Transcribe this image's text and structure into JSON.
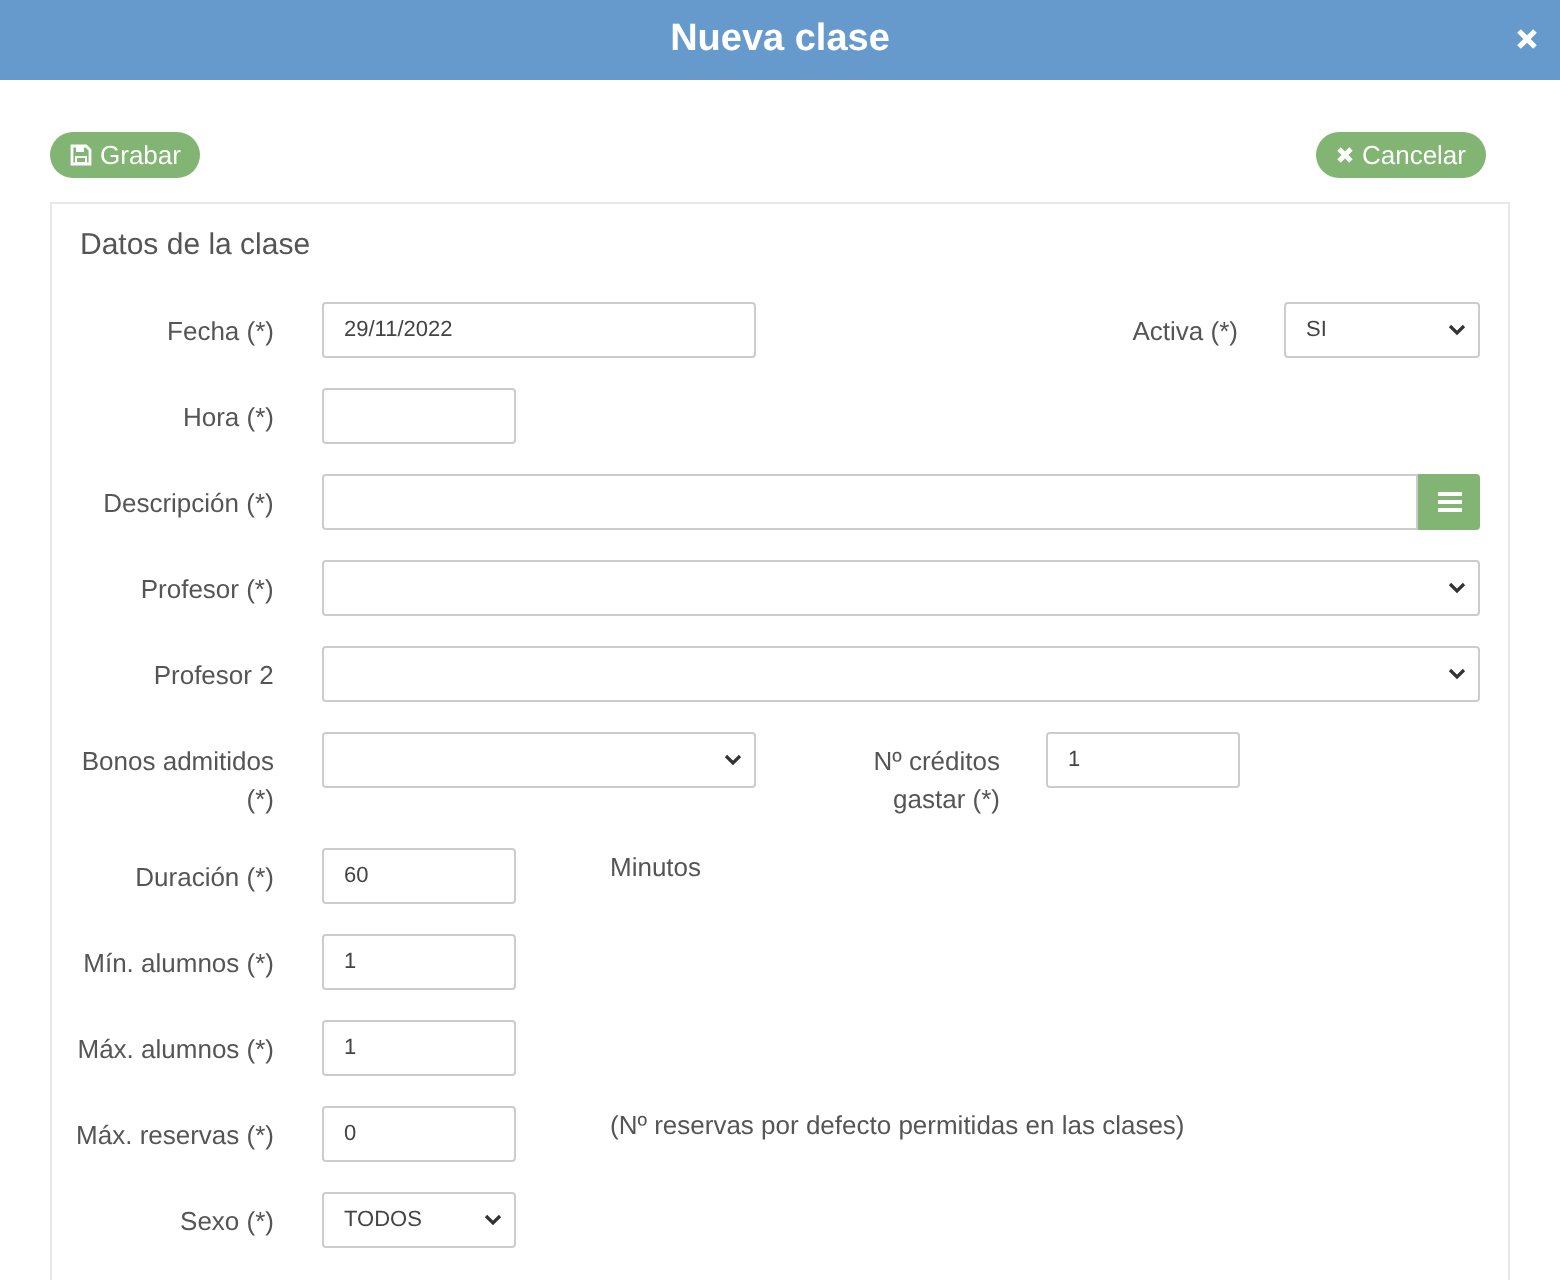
{
  "window": {
    "title": "Nueva clase"
  },
  "toolbar": {
    "save_label": "Grabar",
    "cancel_label": "Cancelar"
  },
  "panel": {
    "title": "Datos de la clase",
    "rows": [
      {
        "label": "Fecha (*)",
        "field": {
          "kind": "input",
          "value": "29/11/2022"
        },
        "extra": {
          "kind": "select",
          "label": "Activa (*)",
          "value": "SI"
        }
      },
      {
        "label": "Hora (*)",
        "field": {
          "kind": "input"
        }
      },
      {
        "label": "Descripción (*)",
        "field": {
          "kind": "picker"
        }
      },
      {
        "label": "Profesor (*)",
        "field": {
          "kind": "select"
        }
      },
      {
        "label": "Profesor 2",
        "field": {
          "kind": "select"
        }
      },
      {
        "label": "Bonos admitidos (*)",
        "field": {
          "kind": "select"
        },
        "extra": {
          "kind": "input",
          "label": "Nº créditos gastar (*)",
          "value": "1"
        }
      },
      {
        "label": "Duración (*)",
        "field": {
          "kind": "input",
          "value": "60"
        },
        "note": "Minutos"
      },
      {
        "label": "Mín. alumnos (*)",
        "field": {
          "kind": "input",
          "value": "1"
        }
      },
      {
        "label": "Máx. alumnos (*)",
        "field": {
          "kind": "input",
          "value": "1"
        }
      },
      {
        "label": "Máx. reservas (*)",
        "field": {
          "kind": "input",
          "value": "0"
        },
        "note": "(Nº reservas por defecto permitidas en las clases)"
      },
      {
        "label": "Sexo (*)",
        "field": {
          "kind": "select",
          "value": "TODOS"
        }
      }
    ]
  }
}
